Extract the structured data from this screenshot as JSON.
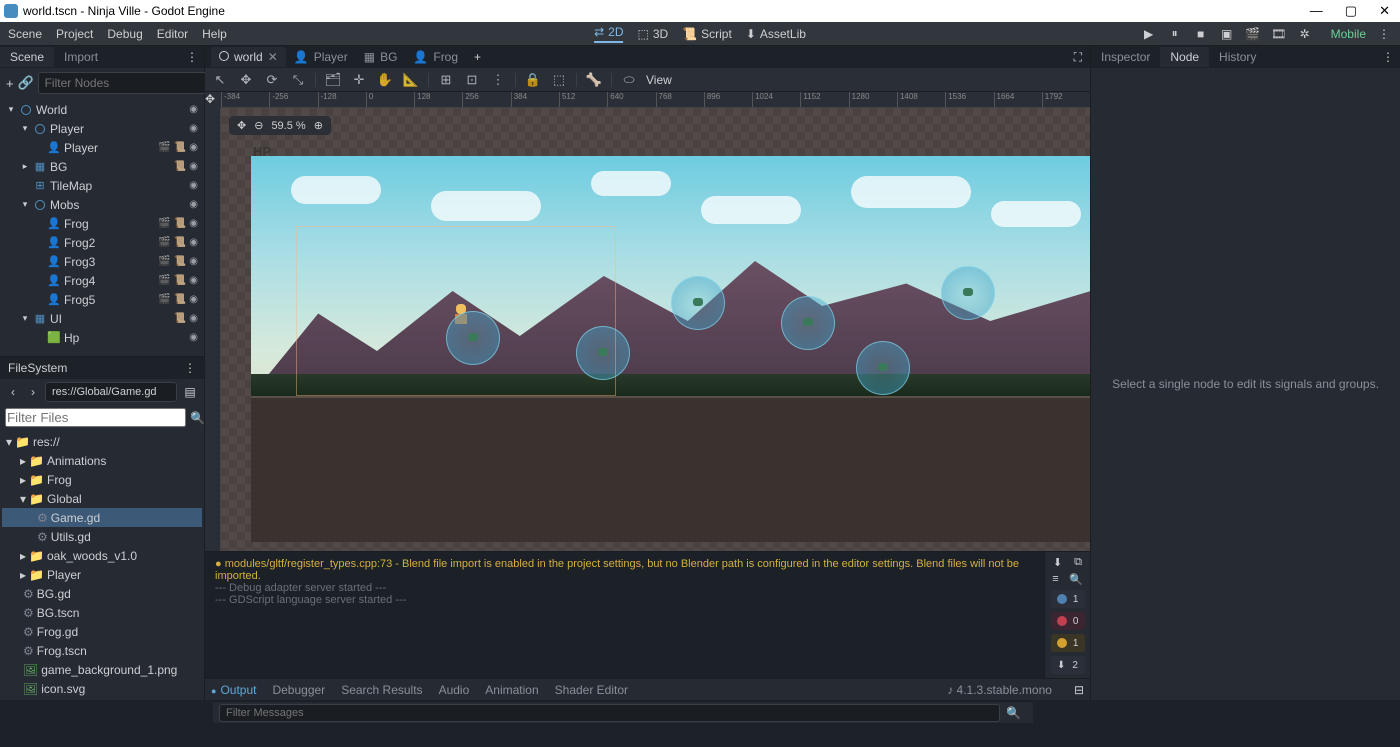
{
  "titlebar": {
    "title": "world.tscn - Ninja Ville - Godot Engine"
  },
  "menubar": {
    "items": [
      "Scene",
      "Project",
      "Debug",
      "Editor",
      "Help"
    ],
    "center": [
      {
        "label": "2D",
        "active": true
      },
      {
        "label": "3D",
        "active": false
      },
      {
        "label": "Script",
        "active": false
      },
      {
        "label": "AssetLib",
        "active": false
      }
    ],
    "mobile": "Mobile"
  },
  "scene_dock": {
    "tabs": [
      "Scene",
      "Import"
    ],
    "active_tab": 0,
    "filter_placeholder": "Filter Nodes",
    "tree": [
      {
        "name": "World",
        "indent": 0,
        "icon": "circle",
        "arrow": "▾",
        "btns": [
          "eye"
        ]
      },
      {
        "name": "Player",
        "indent": 1,
        "icon": "circle",
        "arrow": "▾",
        "btns": [
          "eye"
        ]
      },
      {
        "name": "Player",
        "indent": 2,
        "icon": "sprite",
        "btns": [
          "clap",
          "script",
          "eye"
        ]
      },
      {
        "name": "BG",
        "indent": 1,
        "icon": "layer",
        "arrow": "▸",
        "btns": [
          "script",
          "eye"
        ]
      },
      {
        "name": "TileMap",
        "indent": 1,
        "icon": "grid",
        "btns": [
          "eye"
        ]
      },
      {
        "name": "Mobs",
        "indent": 1,
        "icon": "circle",
        "arrow": "▾",
        "btns": [
          "eye"
        ]
      },
      {
        "name": "Frog",
        "indent": 2,
        "icon": "sprite",
        "btns": [
          "clap",
          "script",
          "eye"
        ]
      },
      {
        "name": "Frog2",
        "indent": 2,
        "icon": "sprite",
        "btns": [
          "clap",
          "script",
          "eye"
        ]
      },
      {
        "name": "Frog3",
        "indent": 2,
        "icon": "sprite",
        "btns": [
          "clap",
          "script",
          "eye"
        ]
      },
      {
        "name": "Frog4",
        "indent": 2,
        "icon": "sprite",
        "btns": [
          "clap",
          "script",
          "eye"
        ]
      },
      {
        "name": "Frog5",
        "indent": 2,
        "icon": "sprite",
        "btns": [
          "clap",
          "script",
          "eye"
        ]
      },
      {
        "name": "UI",
        "indent": 1,
        "icon": "layer",
        "arrow": "▾",
        "btns": [
          "script",
          "eye"
        ]
      },
      {
        "name": "Hp",
        "indent": 2,
        "icon": "prog",
        "btns": [
          "eye"
        ]
      }
    ]
  },
  "filesystem": {
    "header": "FileSystem",
    "path": "res://Global/Game.gd",
    "filter_placeholder": "Filter Files",
    "tree": [
      {
        "name": "res://",
        "indent": 0,
        "icon": "folder",
        "arrow": "▾"
      },
      {
        "name": "Animations",
        "indent": 1,
        "icon": "folder",
        "arrow": "▸"
      },
      {
        "name": "Frog",
        "indent": 1,
        "icon": "folder",
        "arrow": "▸"
      },
      {
        "name": "Global",
        "indent": 1,
        "icon": "folder",
        "arrow": "▾"
      },
      {
        "name": "Game.gd",
        "indent": 2,
        "icon": "gd",
        "selected": true
      },
      {
        "name": "Utils.gd",
        "indent": 2,
        "icon": "gd"
      },
      {
        "name": "oak_woods_v1.0",
        "indent": 1,
        "icon": "folder",
        "arrow": "▸"
      },
      {
        "name": "Player",
        "indent": 1,
        "icon": "folder",
        "arrow": "▸"
      },
      {
        "name": "BG.gd",
        "indent": 1,
        "icon": "gd"
      },
      {
        "name": "BG.tscn",
        "indent": 1,
        "icon": "gd"
      },
      {
        "name": "Frog.gd",
        "indent": 1,
        "icon": "gd"
      },
      {
        "name": "Frog.tscn",
        "indent": 1,
        "icon": "gd"
      },
      {
        "name": "game_background_1.png",
        "indent": 1,
        "icon": "img"
      },
      {
        "name": "icon.svg",
        "indent": 1,
        "icon": "img"
      }
    ]
  },
  "scene_tabs": [
    {
      "label": "world",
      "icon": "circle",
      "active": true,
      "close": true
    },
    {
      "label": "Player",
      "icon": "sprite"
    },
    {
      "label": "BG",
      "icon": "layer"
    },
    {
      "label": "Frog",
      "icon": "sprite"
    }
  ],
  "viewport": {
    "view_menu": "View",
    "zoom": "59.5 %",
    "hp_label": "HP",
    "ruler_ticks": [
      "-384",
      "-256",
      "-128",
      "0",
      "128",
      "256",
      "384",
      "512",
      "640",
      "768",
      "896",
      "1024",
      "1152",
      "1280",
      "1408",
      "1536",
      "1664",
      "1792"
    ]
  },
  "console": {
    "lines": [
      {
        "cls": "warn",
        "text": "modules/gltf/register_types.cpp:73 - Blend file import is enabled in the project settings, but no Blender path is configured in the editor settings. Blend files will not be imported."
      },
      {
        "cls": "dim",
        "text": "--- Debug adapter server started ---"
      },
      {
        "cls": "dim",
        "text": "--- GDScript language server started ---"
      }
    ],
    "counts": {
      "info": "1",
      "err": "0",
      "warn": "1",
      "other": "2"
    }
  },
  "bottom_tabs": [
    "Output",
    "Debugger",
    "Search Results",
    "Audio",
    "Animation",
    "Shader Editor"
  ],
  "bottom_active": 0,
  "filter_messages_placeholder": "Filter Messages",
  "version": "4.1.3.stable.mono",
  "inspector": {
    "tabs": [
      "Inspector",
      "Node",
      "History"
    ],
    "active": 1,
    "placeholder": "Select a single node to edit its signals and groups."
  }
}
